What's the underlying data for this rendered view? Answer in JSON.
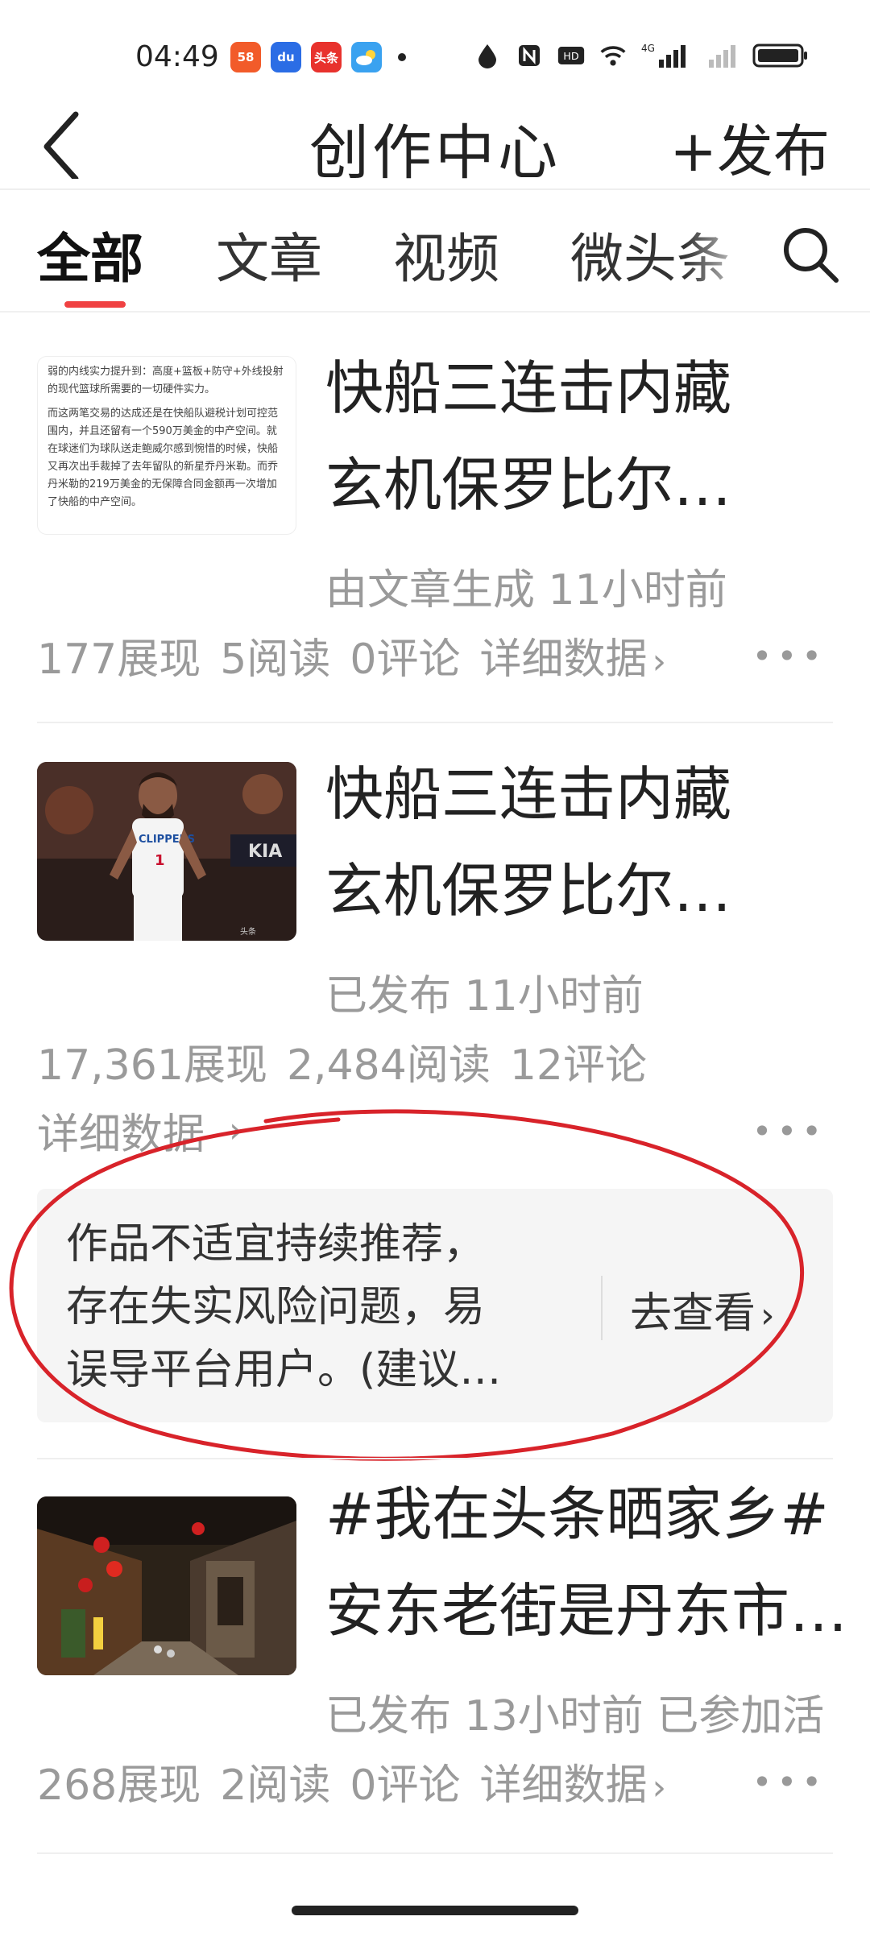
{
  "status_bar": {
    "time": "04:49",
    "apps": [
      {
        "name": "58-app-icon",
        "label": "58",
        "color": "#f25b2a"
      },
      {
        "name": "baidu-app-icon",
        "label": "du",
        "color": "#2b6de5"
      },
      {
        "name": "toutiao-app-icon",
        "label": "头条",
        "color": "#e8322d"
      },
      {
        "name": "weather-app-icon",
        "label": "",
        "color": "#3aa2f0"
      }
    ],
    "network": "4G"
  },
  "header": {
    "title": "创作中心",
    "publish_label": "+发布"
  },
  "tabs": [
    {
      "label": "全部",
      "active": true
    },
    {
      "label": "文章",
      "active": false
    },
    {
      "label": "视频",
      "active": false
    },
    {
      "label": "微头条",
      "active": false
    }
  ],
  "items": [
    {
      "thumb_text": [
        "弱的内线实力提升到：高度+篮板+防守+外线投射的现代篮球所需要的一切硬件实力。",
        "而这两笔交易的达成还是在快船队避税计划可控范围内，并且还留有一个590万美金的中产空间。就在球迷们为球队送走鲍威尔感到惋惜的时候，快船又再次出手裁掉了去年留队的新星乔丹米勒。而乔丹米勒的219万美金的无保障合同金额再一次增加了快船的中产空间。"
      ],
      "title_line1": "快船三连击内藏",
      "title_line2": "玄机保罗比尔…",
      "meta": "由文章生成  11小时前",
      "impressions": "177展现",
      "reads": "5阅读",
      "comments": "0评论",
      "details": "详细数据"
    },
    {
      "title_line1": "快船三连击内藏",
      "title_line2": "玄机保罗比尔…",
      "meta": "已发布  11小时前",
      "impressions": "17,361展现",
      "reads": "2,484阅读",
      "comments": "12评论",
      "details": "详细数据",
      "notice": {
        "line1": "作品不适宜持续推荐，",
        "line2": "存在失实风险问题，易",
        "line3": "误导平台用户。(建议…",
        "action": "去查看"
      }
    },
    {
      "title_line1": "#我在头条晒家乡#",
      "title_line2": "安东老街是丹东市…",
      "meta": "已发布  13小时前  已参加活",
      "impressions": "268展现",
      "reads": "2阅读",
      "comments": "0评论",
      "details": "详细数据"
    }
  ],
  "colors": {
    "accent": "#f04142",
    "annotation_circle": "#d8232a",
    "muted_text": "#9a9a9a"
  }
}
